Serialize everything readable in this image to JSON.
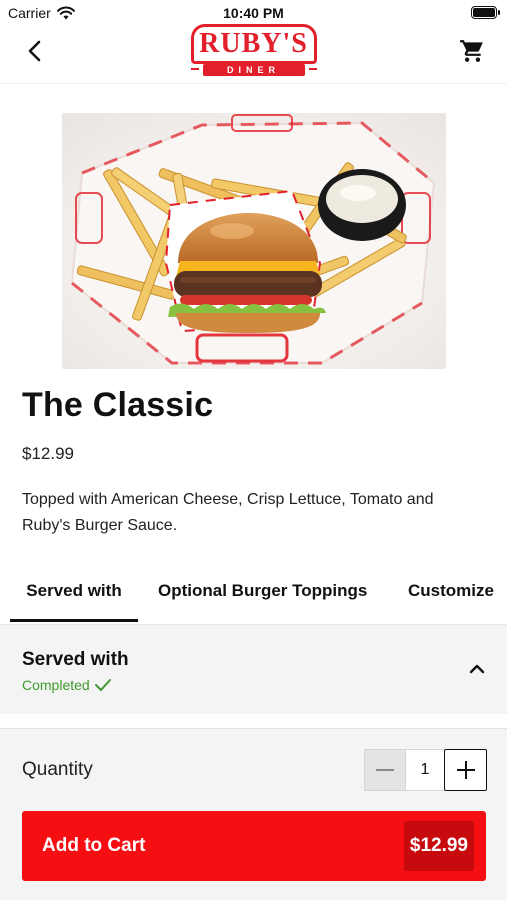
{
  "status_bar": {
    "carrier": "Carrier",
    "time": "10:40 PM"
  },
  "header": {
    "back_icon": "chevron-left-icon",
    "cart_icon": "shopping-cart-icon",
    "logo_text": "RUBY'S",
    "logo_subtext": "DINER",
    "brand_color": "#e2202b"
  },
  "product": {
    "image_desc_icon": "burger-fries-photo",
    "name": "The Classic",
    "price": "$12.99",
    "description": "Topped with American Cheese, Crisp Lettuce, Tomato and Ruby's Burger Sauce."
  },
  "tabs": [
    {
      "label": "Served with",
      "active": true
    },
    {
      "label": "Optional Burger Toppings",
      "active": false
    },
    {
      "label": "Customize",
      "active": false
    }
  ],
  "section": {
    "title": "Served with",
    "status": "Completed",
    "status_color": "#3e9a2d",
    "toggle_icon": "chevron-up-icon"
  },
  "order": {
    "quantity_label": "Quantity",
    "quantity_value": "1",
    "add_button_label": "Add to Cart",
    "add_button_price": "$12.99",
    "button_color": "#f50e12"
  }
}
